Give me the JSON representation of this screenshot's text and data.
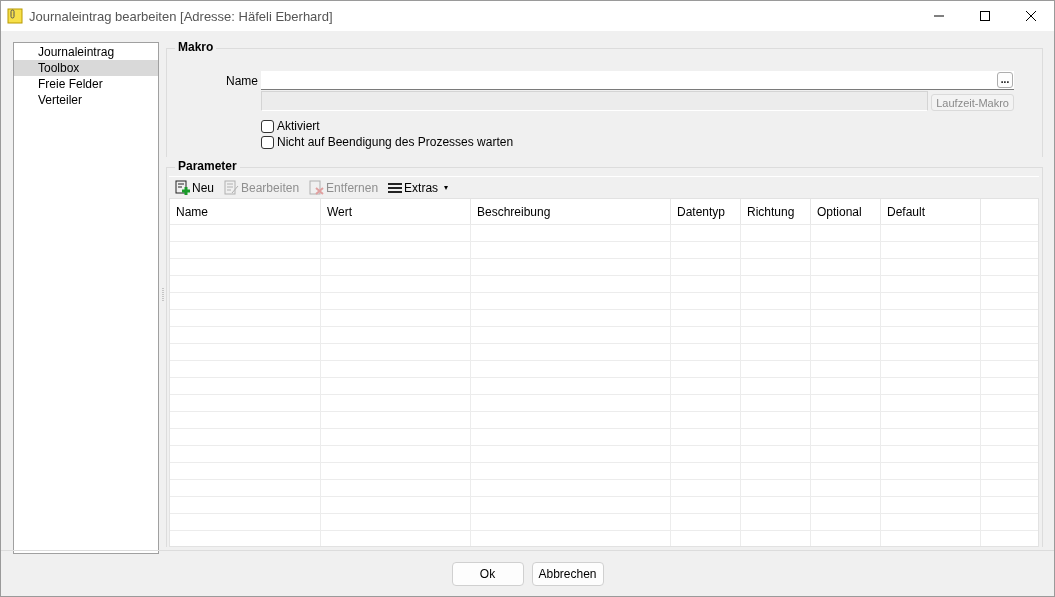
{
  "window": {
    "title": "Journaleintrag bearbeiten [Adresse: Häfeli Eberhard]"
  },
  "sidebar": {
    "items": [
      {
        "label": "Journaleintrag",
        "selected": false
      },
      {
        "label": "Toolbox",
        "selected": true
      },
      {
        "label": "Freie Felder",
        "selected": false
      },
      {
        "label": "Verteiler",
        "selected": false
      }
    ]
  },
  "makro": {
    "title": "Makro",
    "name_label": "Name",
    "browse_button": "...",
    "runtime_button": {
      "label": "Laufzeit-Makro",
      "disabled": true
    },
    "checkboxes": [
      {
        "label": "Aktiviert",
        "checked": false
      },
      {
        "label": "Nicht auf Beendigung des Prozesses warten",
        "checked": false
      }
    ]
  },
  "parameter": {
    "title": "Parameter",
    "toolbar": [
      {
        "kind": "new",
        "label": "Neu",
        "disabled": false
      },
      {
        "kind": "edit",
        "label": "Bearbeiten",
        "disabled": true
      },
      {
        "kind": "delete",
        "label": "Entfernen",
        "disabled": true
      },
      {
        "kind": "menu",
        "label": "Extras",
        "disabled": false,
        "caret": "▾"
      }
    ],
    "columns": [
      "Name",
      "Wert",
      "Beschreibung",
      "Datentyp",
      "Richtung",
      "Optional",
      "Default"
    ]
  },
  "buttons": [
    "Ok",
    "Abbrechen"
  ]
}
